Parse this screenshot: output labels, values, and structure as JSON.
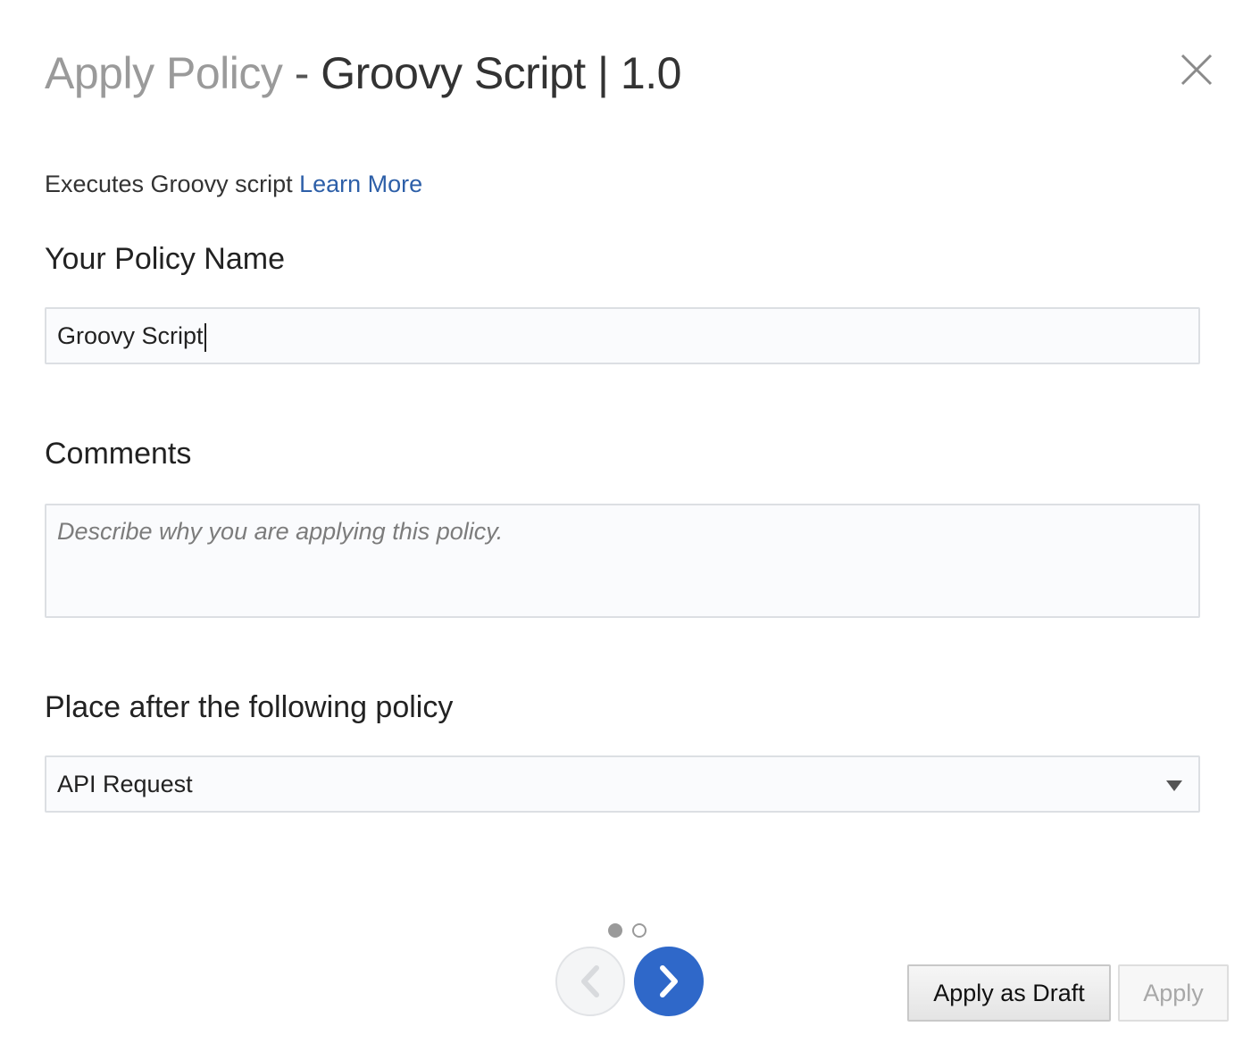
{
  "dialog": {
    "title_prefix": "Apply Policy",
    "title_separator": " - ",
    "title_name": "Groovy Script | 1.0",
    "close_icon": "close-icon"
  },
  "description": {
    "text": "Executes Groovy script ",
    "link_label": "Learn More"
  },
  "policy_name": {
    "label": "Your Policy Name",
    "value": "Groovy Script"
  },
  "comments": {
    "label": "Comments",
    "placeholder": "Describe why you are applying this policy."
  },
  "placement": {
    "label": "Place after the following policy",
    "selected": "API Request",
    "arrow_icon": "caret-down-icon"
  },
  "pagination": {
    "current_page": 1,
    "total_pages": 2,
    "prev_icon": "chevron-left-icon",
    "next_icon": "chevron-right-icon"
  },
  "footer": {
    "draft_label": "Apply as Draft",
    "apply_label": "Apply"
  },
  "colors": {
    "link": "#2d5fa8",
    "next_button": "#2f68c9",
    "disabled_text": "#a8a8a8"
  }
}
